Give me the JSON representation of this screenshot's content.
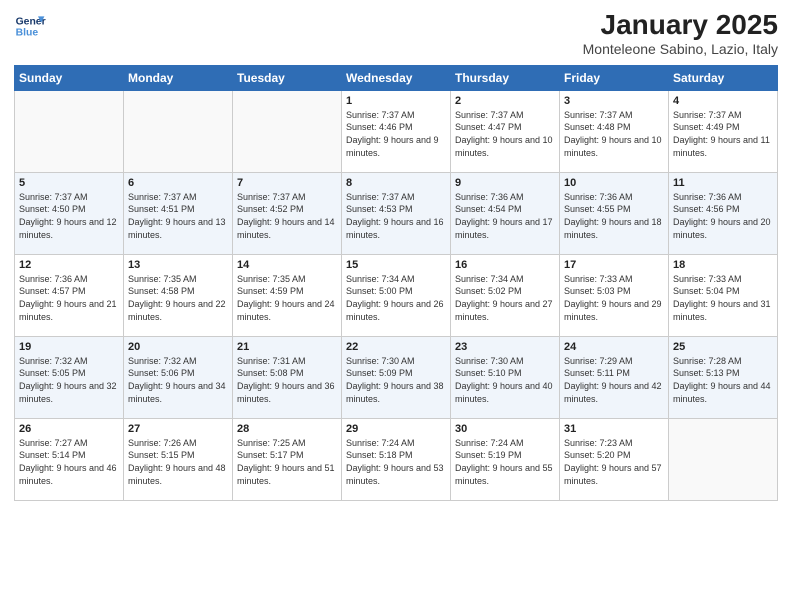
{
  "header": {
    "logo_line1": "General",
    "logo_line2": "Blue",
    "month": "January 2025",
    "location": "Monteleone Sabino, Lazio, Italy"
  },
  "weekdays": [
    "Sunday",
    "Monday",
    "Tuesday",
    "Wednesday",
    "Thursday",
    "Friday",
    "Saturday"
  ],
  "weeks": [
    [
      {
        "day": "",
        "sunrise": "",
        "sunset": "",
        "daylight": ""
      },
      {
        "day": "",
        "sunrise": "",
        "sunset": "",
        "daylight": ""
      },
      {
        "day": "",
        "sunrise": "",
        "sunset": "",
        "daylight": ""
      },
      {
        "day": "1",
        "sunrise": "Sunrise: 7:37 AM",
        "sunset": "Sunset: 4:46 PM",
        "daylight": "Daylight: 9 hours and 9 minutes."
      },
      {
        "day": "2",
        "sunrise": "Sunrise: 7:37 AM",
        "sunset": "Sunset: 4:47 PM",
        "daylight": "Daylight: 9 hours and 10 minutes."
      },
      {
        "day": "3",
        "sunrise": "Sunrise: 7:37 AM",
        "sunset": "Sunset: 4:48 PM",
        "daylight": "Daylight: 9 hours and 10 minutes."
      },
      {
        "day": "4",
        "sunrise": "Sunrise: 7:37 AM",
        "sunset": "Sunset: 4:49 PM",
        "daylight": "Daylight: 9 hours and 11 minutes."
      }
    ],
    [
      {
        "day": "5",
        "sunrise": "Sunrise: 7:37 AM",
        "sunset": "Sunset: 4:50 PM",
        "daylight": "Daylight: 9 hours and 12 minutes."
      },
      {
        "day": "6",
        "sunrise": "Sunrise: 7:37 AM",
        "sunset": "Sunset: 4:51 PM",
        "daylight": "Daylight: 9 hours and 13 minutes."
      },
      {
        "day": "7",
        "sunrise": "Sunrise: 7:37 AM",
        "sunset": "Sunset: 4:52 PM",
        "daylight": "Daylight: 9 hours and 14 minutes."
      },
      {
        "day": "8",
        "sunrise": "Sunrise: 7:37 AM",
        "sunset": "Sunset: 4:53 PM",
        "daylight": "Daylight: 9 hours and 16 minutes."
      },
      {
        "day": "9",
        "sunrise": "Sunrise: 7:36 AM",
        "sunset": "Sunset: 4:54 PM",
        "daylight": "Daylight: 9 hours and 17 minutes."
      },
      {
        "day": "10",
        "sunrise": "Sunrise: 7:36 AM",
        "sunset": "Sunset: 4:55 PM",
        "daylight": "Daylight: 9 hours and 18 minutes."
      },
      {
        "day": "11",
        "sunrise": "Sunrise: 7:36 AM",
        "sunset": "Sunset: 4:56 PM",
        "daylight": "Daylight: 9 hours and 20 minutes."
      }
    ],
    [
      {
        "day": "12",
        "sunrise": "Sunrise: 7:36 AM",
        "sunset": "Sunset: 4:57 PM",
        "daylight": "Daylight: 9 hours and 21 minutes."
      },
      {
        "day": "13",
        "sunrise": "Sunrise: 7:35 AM",
        "sunset": "Sunset: 4:58 PM",
        "daylight": "Daylight: 9 hours and 22 minutes."
      },
      {
        "day": "14",
        "sunrise": "Sunrise: 7:35 AM",
        "sunset": "Sunset: 4:59 PM",
        "daylight": "Daylight: 9 hours and 24 minutes."
      },
      {
        "day": "15",
        "sunrise": "Sunrise: 7:34 AM",
        "sunset": "Sunset: 5:00 PM",
        "daylight": "Daylight: 9 hours and 26 minutes."
      },
      {
        "day": "16",
        "sunrise": "Sunrise: 7:34 AM",
        "sunset": "Sunset: 5:02 PM",
        "daylight": "Daylight: 9 hours and 27 minutes."
      },
      {
        "day": "17",
        "sunrise": "Sunrise: 7:33 AM",
        "sunset": "Sunset: 5:03 PM",
        "daylight": "Daylight: 9 hours and 29 minutes."
      },
      {
        "day": "18",
        "sunrise": "Sunrise: 7:33 AM",
        "sunset": "Sunset: 5:04 PM",
        "daylight": "Daylight: 9 hours and 31 minutes."
      }
    ],
    [
      {
        "day": "19",
        "sunrise": "Sunrise: 7:32 AM",
        "sunset": "Sunset: 5:05 PM",
        "daylight": "Daylight: 9 hours and 32 minutes."
      },
      {
        "day": "20",
        "sunrise": "Sunrise: 7:32 AM",
        "sunset": "Sunset: 5:06 PM",
        "daylight": "Daylight: 9 hours and 34 minutes."
      },
      {
        "day": "21",
        "sunrise": "Sunrise: 7:31 AM",
        "sunset": "Sunset: 5:08 PM",
        "daylight": "Daylight: 9 hours and 36 minutes."
      },
      {
        "day": "22",
        "sunrise": "Sunrise: 7:30 AM",
        "sunset": "Sunset: 5:09 PM",
        "daylight": "Daylight: 9 hours and 38 minutes."
      },
      {
        "day": "23",
        "sunrise": "Sunrise: 7:30 AM",
        "sunset": "Sunset: 5:10 PM",
        "daylight": "Daylight: 9 hours and 40 minutes."
      },
      {
        "day": "24",
        "sunrise": "Sunrise: 7:29 AM",
        "sunset": "Sunset: 5:11 PM",
        "daylight": "Daylight: 9 hours and 42 minutes."
      },
      {
        "day": "25",
        "sunrise": "Sunrise: 7:28 AM",
        "sunset": "Sunset: 5:13 PM",
        "daylight": "Daylight: 9 hours and 44 minutes."
      }
    ],
    [
      {
        "day": "26",
        "sunrise": "Sunrise: 7:27 AM",
        "sunset": "Sunset: 5:14 PM",
        "daylight": "Daylight: 9 hours and 46 minutes."
      },
      {
        "day": "27",
        "sunrise": "Sunrise: 7:26 AM",
        "sunset": "Sunset: 5:15 PM",
        "daylight": "Daylight: 9 hours and 48 minutes."
      },
      {
        "day": "28",
        "sunrise": "Sunrise: 7:25 AM",
        "sunset": "Sunset: 5:17 PM",
        "daylight": "Daylight: 9 hours and 51 minutes."
      },
      {
        "day": "29",
        "sunrise": "Sunrise: 7:24 AM",
        "sunset": "Sunset: 5:18 PM",
        "daylight": "Daylight: 9 hours and 53 minutes."
      },
      {
        "day": "30",
        "sunrise": "Sunrise: 7:24 AM",
        "sunset": "Sunset: 5:19 PM",
        "daylight": "Daylight: 9 hours and 55 minutes."
      },
      {
        "day": "31",
        "sunrise": "Sunrise: 7:23 AM",
        "sunset": "Sunset: 5:20 PM",
        "daylight": "Daylight: 9 hours and 57 minutes."
      },
      {
        "day": "",
        "sunrise": "",
        "sunset": "",
        "daylight": ""
      }
    ]
  ]
}
